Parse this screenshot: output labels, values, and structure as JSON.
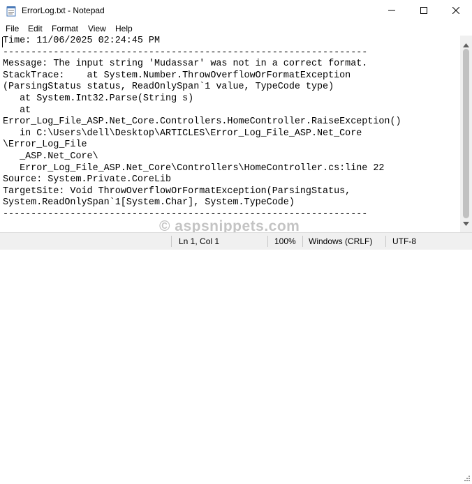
{
  "window": {
    "title": "ErrorLog.txt - Notepad",
    "icon": "notepad-icon"
  },
  "menu": {
    "file": "File",
    "edit": "Edit",
    "format": "Format",
    "view": "View",
    "help": "Help"
  },
  "editor": {
    "lines": [
      "Time: 11/06/2025 02:24:45 PM",
      "-----------------------------------------------------------------",
      "Message: The input string 'Mudassar' was not in a correct format.",
      "StackTrace:    at System.Number.ThrowOverflowOrFormatException",
      "(ParsingStatus status, ReadOnlySpan`1 value, TypeCode type)",
      "   at System.Int32.Parse(String s)",
      "   at",
      "Error_Log_File_ASP.Net_Core.Controllers.HomeController.RaiseException()",
      "   in C:\\Users\\dell\\Desktop\\ARTICLES\\Error_Log_File_ASP.Net_Core",
      "\\Error_Log_File",
      "   _ASP.Net_Core\\",
      "   Error_Log_File_ASP.Net_Core\\Controllers\\HomeController.cs:line 22",
      "Source: System.Private.CoreLib",
      "TargetSite: Void ThrowOverflowOrFormatException(ParsingStatus,",
      "System.ReadOnlySpan`1[System.Char], System.TypeCode)",
      "-----------------------------------------------------------------"
    ]
  },
  "status": {
    "position": "Ln 1, Col 1",
    "zoom": "100%",
    "line_ending": "Windows (CRLF)",
    "encoding": "UTF-8"
  },
  "watermark": "© aspsnippets.com"
}
